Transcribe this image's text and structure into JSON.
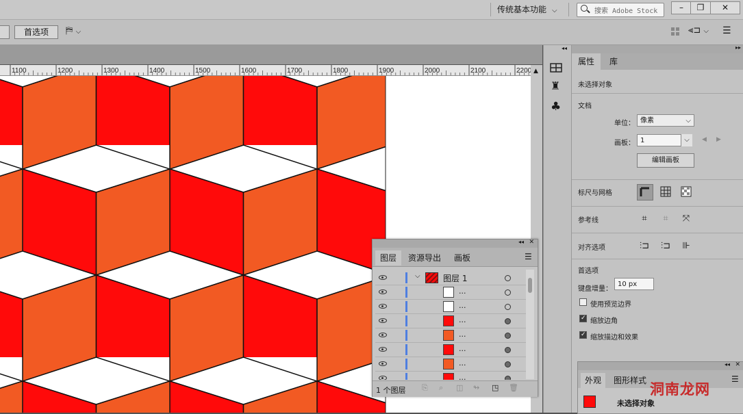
{
  "titlebar": {
    "workspace": "传统基本功能",
    "search_placeholder": "搜索 Adobe Stock",
    "minimize": "–",
    "restore": "❐",
    "close": "✕"
  },
  "controlbar": {
    "preferences_button": "首选项",
    "left_button": ""
  },
  "ruler": {
    "ticks": [
      "1100",
      "1200",
      "1300",
      "1400",
      "1500",
      "1600",
      "1700",
      "1800",
      "1900",
      "2000",
      "2100",
      "2200"
    ]
  },
  "properties": {
    "tabs": [
      "属性",
      "库"
    ],
    "active_tab": "属性",
    "selection": "未选择对象",
    "document": {
      "title": "文档",
      "units_label": "单位：",
      "units_value": "像素",
      "artboard_label": "画板：",
      "artboard_value": "1",
      "edit_artboards": "编辑画板"
    },
    "rulers_grids": "标尺与网格",
    "guides": "参考线",
    "align": "对齐选项",
    "preferences": {
      "title": "首选项",
      "keyboard_increment_label": "键盘增量：",
      "keyboard_increment_value": "10 px",
      "use_preview_bounds": "使用预览边界",
      "use_preview_bounds_checked": false,
      "scale_corners": "缩放边角",
      "scale_corners_checked": true,
      "scale_strokes": "缩放描边和效果",
      "scale_strokes_checked": true
    }
  },
  "layers_panel": {
    "tabs": [
      "图层",
      "资源导出",
      "画板"
    ],
    "active_tab": "图层",
    "top_layer": "图层 1",
    "sublayers": [
      {
        "name": "...",
        "thumb": "white",
        "targeted": false
      },
      {
        "name": "...",
        "thumb": "white",
        "targeted": false
      },
      {
        "name": "...",
        "thumb": "red",
        "targeted": true
      },
      {
        "name": "...",
        "thumb": "orange",
        "targeted": true
      },
      {
        "name": "...",
        "thumb": "red",
        "targeted": true
      },
      {
        "name": "...",
        "thumb": "orange",
        "targeted": true
      },
      {
        "name": "...",
        "thumb": "red",
        "targeted": true
      }
    ],
    "footer_count": "1 个图层"
  },
  "appearance_panel": {
    "tabs": [
      "外观",
      "图形样式"
    ],
    "active_tab": "外观",
    "selection": "未选择对象"
  },
  "watermark": "洞南龙网",
  "colors": {
    "red": "#ff0a0a",
    "orange": "#f25a23",
    "white": "#ffffff",
    "ui_light": "#c3c3c3",
    "ui_dark": "#535353",
    "layer_color": "#4f7fe0"
  }
}
